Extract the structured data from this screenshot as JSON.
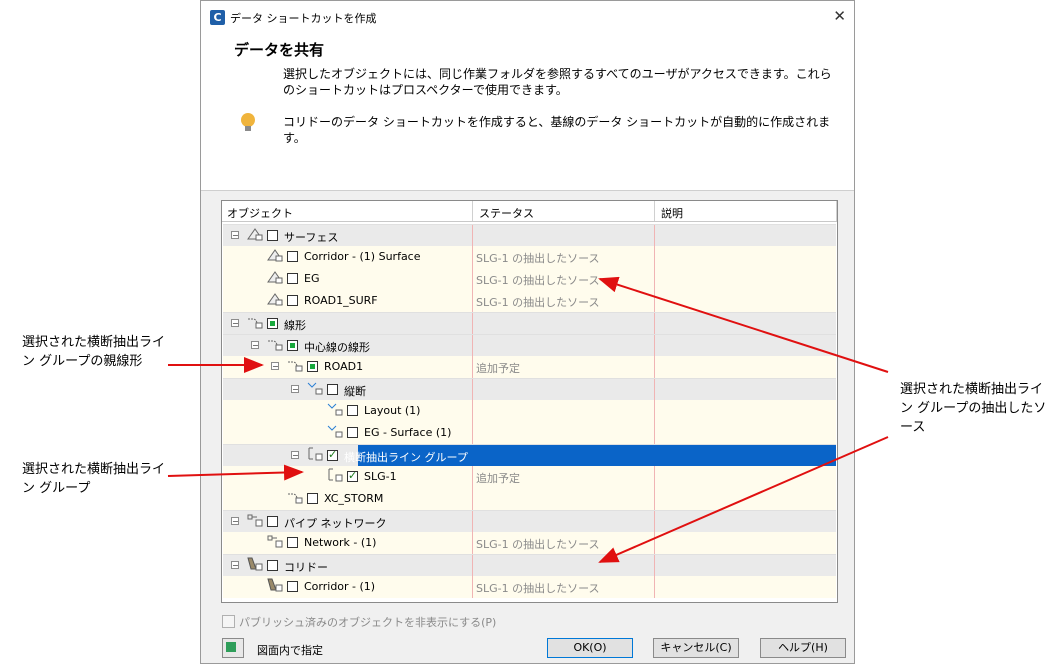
{
  "window": {
    "title": "データ ショートカットを作成",
    "app_icon": "civil3d-icon",
    "close": "✕"
  },
  "header": {
    "title": "データを共有",
    "description": "選択したオブジェクトには、同じ作業フォルダを参照するすべてのユーザがアクセスできます。これらのショートカットはプロスペクターで使用できます。",
    "note": "コリドーのデータ ショートカットを作成すると、基線のデータ ショートカットが自動的に作成されます。"
  },
  "grid": {
    "columns": [
      "オブジェクト",
      "ステータス",
      "説明"
    ],
    "rows": [
      {
        "label": "サーフェス",
        "status": ""
      },
      {
        "label": "Corridor - (1) Surface",
        "status": "SLG-1 の抽出したソース"
      },
      {
        "label": "EG",
        "status": "SLG-1 の抽出したソース"
      },
      {
        "label": "ROAD1_SURF",
        "status": "SLG-1 の抽出したソース"
      },
      {
        "label": "線形",
        "status": ""
      },
      {
        "label": "中心線の線形",
        "status": ""
      },
      {
        "label": "ROAD1",
        "status": "追加予定"
      },
      {
        "label": "縦断",
        "status": ""
      },
      {
        "label": "Layout (1)",
        "status": ""
      },
      {
        "label": "EG - Surface (1)",
        "status": ""
      },
      {
        "label": "横断抽出ライン グループ",
        "status": ""
      },
      {
        "label": "SLG-1",
        "status": "追加予定"
      },
      {
        "label": "XC_STORM",
        "status": ""
      },
      {
        "label": "パイプ ネットワーク",
        "status": ""
      },
      {
        "label": "Network - (1)",
        "status": "SLG-1 の抽出したソース"
      },
      {
        "label": "コリドー",
        "status": ""
      },
      {
        "label": "Corridor - (1)",
        "status": "SLG-1 の抽出したソース"
      }
    ]
  },
  "footer": {
    "hide_published": "パブリッシュ済みのオブジェクトを非表示にする(P)",
    "pick_in_drawing": "図面内で指定",
    "ok": "OK(O)",
    "cancel": "キャンセル(C)",
    "help": "ヘルプ(H)"
  },
  "annotations": {
    "parent_alignment": "選択された横断抽出ライン グループの親線形",
    "source": "選択された横断抽出ライン グループの抽出したソース",
    "slg": "選択された横断抽出ライン グループ"
  },
  "colors": {
    "selected": "#0a64c8",
    "arrow": "#e01010",
    "leaf_bg": "#fffced"
  }
}
